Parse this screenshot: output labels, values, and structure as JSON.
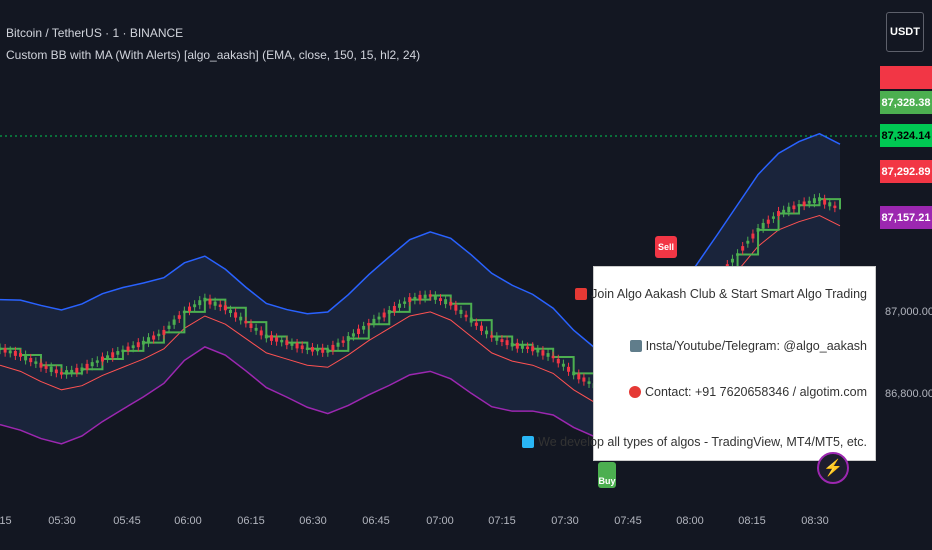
{
  "header": {
    "symbol_line": "Bitcoin / TetherUS · 1 · BINANCE",
    "indicator_line": "Custom BB with MA (With Alerts) [algo_aakash] (EMA, close, 150, 15, hl2, 24)"
  },
  "price_axis": {
    "currency_button": "USDT",
    "tags": [
      {
        "label": "87,328.38",
        "color": "#4caf50"
      },
      {
        "label": "87,324.14",
        "color": "#00c853"
      },
      {
        "label": "87,292.89",
        "color": "#f23645"
      },
      {
        "label": "87,157.21",
        "color": "#9c27b0"
      }
    ],
    "labels": [
      "87,000.00",
      "86,800.00"
    ]
  },
  "time_axis": {
    "labels": [
      ":15",
      "05:30",
      "05:45",
      "06:00",
      "06:15",
      "06:30",
      "06:45",
      "07:00",
      "07:15",
      "07:30",
      "07:45",
      "08:00",
      "08:15",
      "08:30"
    ]
  },
  "signals": {
    "sell_label": "Sell",
    "buy_label": "Buy"
  },
  "info_box": {
    "lines": [
      {
        "icon": "rocket-icon",
        "text": "Join Algo Aakash Club & Start Smart Algo Trading"
      },
      {
        "icon": "phone-icon",
        "text": "Insta/Youtube/Telegram: @algo_aakash"
      },
      {
        "icon": "telephone-icon",
        "text": "Contact: +91 7620658346 / algotim.com"
      },
      {
        "icon": "computer-icon",
        "text": "We develop all types of algos - TradingView, MT4/MT5, etc."
      }
    ]
  },
  "colors": {
    "background": "#131722",
    "bull": "#4caf50",
    "bear": "#f23645",
    "band_upper": "#2962ff",
    "band_lower": "#9c27b0",
    "ma_line": "#ff5252",
    "step_line": "#4caf50"
  },
  "chart_data": {
    "type": "candlestick",
    "x_label": "",
    "y_label": "",
    "y_ticks": [
      "87,000.00",
      "86,800.00"
    ],
    "x_ticks": [
      ":15",
      "05:30",
      "05:45",
      "06:00",
      "06:15",
      "06:30",
      "06:45",
      "07:00",
      "07:15",
      "07:30",
      "07:45",
      "08:00",
      "08:15",
      "08:30"
    ],
    "series": [
      {
        "name": "mid",
        "values": [
          86920,
          86905,
          86880,
          86860,
          86870,
          86895,
          86915,
          86935,
          86960,
          87010,
          87040,
          87020,
          86985,
          86950,
          86935,
          86920,
          86915,
          86945,
          86980,
          87010,
          87040,
          87050,
          87030,
          86990,
          86950,
          86930,
          86920,
          86900,
          86860,
          86830,
          86835,
          86870,
          86920,
          86970,
          87030,
          87090,
          87150,
          87210,
          87250,
          87270,
          87285,
          87260
        ]
      }
    ]
  }
}
